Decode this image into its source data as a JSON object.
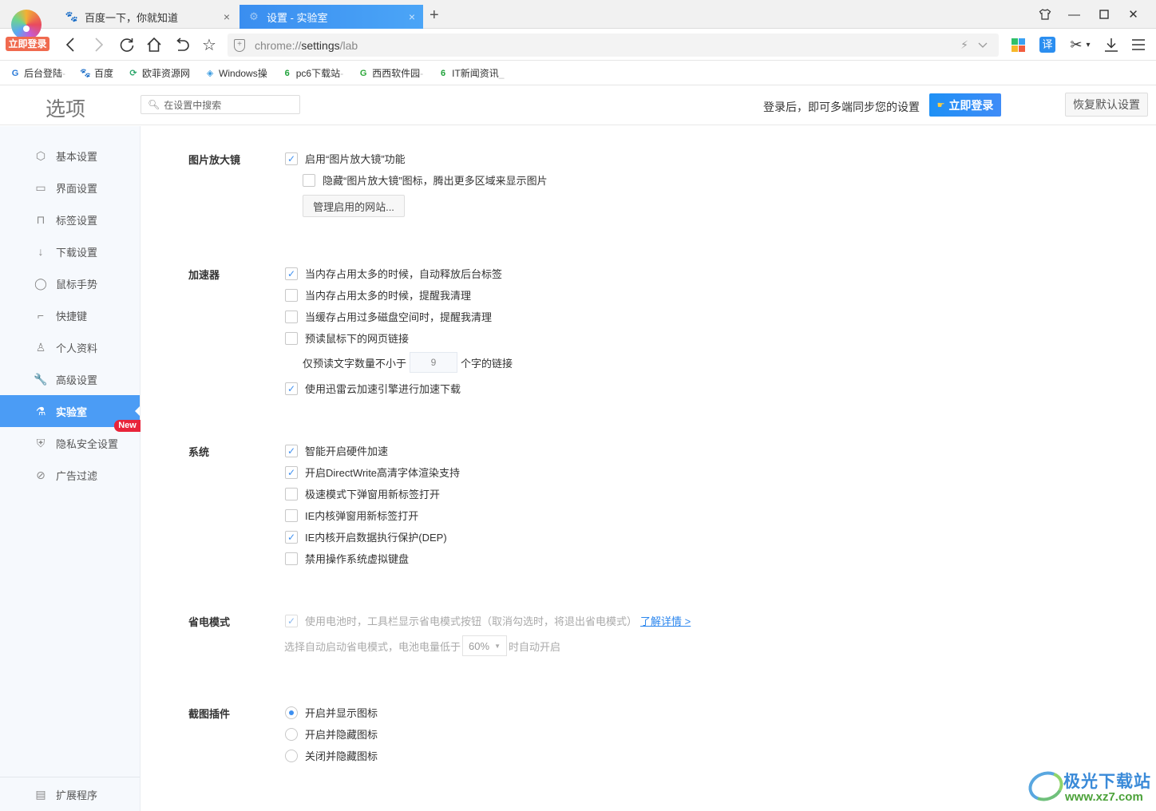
{
  "browser": {
    "logo_badge": "立即登录",
    "tabs": [
      {
        "title": "百度一下，你就知道",
        "icon": "baidu-paw-icon",
        "active": false,
        "close": "×"
      },
      {
        "title": "设置 - 实验室",
        "icon": "gear-icon",
        "active": true,
        "close": "×"
      }
    ],
    "new_tab": "+",
    "window_controls": {
      "skin": "shirt-icon",
      "minimize": "—",
      "maximize": "☐",
      "close": "✕"
    },
    "nav": {
      "back": "‹",
      "forward": "›",
      "reload": "↻",
      "home": "⌂",
      "undo": "↶",
      "bookmark": "☆"
    },
    "address": {
      "prefix": "chrome://",
      "main": "settings",
      "suffix": "/lab",
      "bolt": "⚡",
      "dropdown": "⌄"
    },
    "toolbar": {
      "translate": "译",
      "cut": "✂",
      "cut_dropdown": "▾",
      "download": "⤓",
      "menu": "☰"
    },
    "bookmarks": [
      {
        "label": "后台登陆",
        "trail": "-",
        "icon_char": "G",
        "color": "#2b7bd8"
      },
      {
        "label": "百度",
        "trail": "",
        "icon_char": "🐾",
        "color": "#2b5fd8"
      },
      {
        "label": "欧菲资源网",
        "trail": "",
        "icon_char": "⟳",
        "color": "#2aa66a"
      },
      {
        "label": "Windows操",
        "trail": "",
        "icon_char": "◈",
        "color": "#3a9be0"
      },
      {
        "label": "pc6下载站",
        "trail": "-",
        "icon_char": "6",
        "color": "#1fa23a"
      },
      {
        "label": "西西软件园",
        "trail": "-",
        "icon_char": "G",
        "color": "#2ea83b"
      },
      {
        "label": "IT新闻资讯",
        "trail": "_",
        "icon_char": "6",
        "color": "#1fa23a"
      }
    ]
  },
  "header": {
    "title": "选项",
    "search_placeholder": "在设置中搜索",
    "sync_text": "登录后，即可多端同步您的设置",
    "login_button": "立即登录",
    "reset_button": "恢复默认设置"
  },
  "sidebar": {
    "items": [
      {
        "label": "基本设置",
        "icon": "⬡",
        "icon_name": "basic-settings-icon"
      },
      {
        "label": "界面设置",
        "icon": "▭",
        "icon_name": "window-icon"
      },
      {
        "label": "标签设置",
        "icon": "⊓",
        "icon_name": "tab-icon"
      },
      {
        "label": "下载设置",
        "icon": "↓",
        "icon_name": "download-icon"
      },
      {
        "label": "鼠标手势",
        "icon": "◯",
        "icon_name": "mouse-icon"
      },
      {
        "label": "快捷键",
        "icon": "⌐",
        "icon_name": "keyboard-icon"
      },
      {
        "label": "个人资料",
        "icon": "♙",
        "icon_name": "user-icon"
      },
      {
        "label": "高级设置",
        "icon": "🔧",
        "icon_name": "wrench-icon"
      },
      {
        "label": "实验室",
        "icon": "⚗",
        "icon_name": "flask-icon",
        "active": true
      },
      {
        "label": "隐私安全设置",
        "icon": "⛨",
        "icon_name": "shield-icon"
      },
      {
        "label": "广告过滤",
        "icon": "⊘",
        "icon_name": "block-icon"
      }
    ],
    "new_badge": "New",
    "extensions": {
      "label": "扩展程序",
      "icon": "▤"
    }
  },
  "sections": {
    "magnifier": {
      "title": "图片放大镜",
      "options": [
        {
          "label": "启用“图片放大镜”功能",
          "checked": true
        },
        {
          "label": "隐藏“图片放大镜”图标，腾出更多区域来显示图片",
          "checked": false
        }
      ],
      "manage_button": "管理启用的网站..."
    },
    "accelerator": {
      "title": "加速器",
      "options": [
        {
          "label": "当内存占用太多的时候，自动释放后台标签",
          "checked": true
        },
        {
          "label": "当内存占用太多的时候，提醒我清理",
          "checked": false
        },
        {
          "label": "当缓存占用过多磁盘空间时，提醒我清理",
          "checked": false
        },
        {
          "label": "预读鼠标下的网页链接",
          "checked": false
        }
      ],
      "prefetch_prefix": "仅预读文字数量不小于",
      "prefetch_value": "9",
      "prefetch_suffix": "个字的链接",
      "thunder": {
        "label": "使用迅雷云加速引擎进行加速下载",
        "checked": true
      }
    },
    "system": {
      "title": "系统",
      "options": [
        {
          "label": "智能开启硬件加速",
          "checked": true
        },
        {
          "label": "开启DirectWrite高清字体渲染支持",
          "checked": true
        },
        {
          "label": "极速模式下弹窗用新标签打开",
          "checked": false
        },
        {
          "label": "IE内核弹窗用新标签打开",
          "checked": false
        },
        {
          "label": "IE内核开启数据执行保护(DEP)",
          "checked": true
        },
        {
          "label": "禁用操作系统虚拟键盘",
          "checked": false
        }
      ]
    },
    "power": {
      "title": "省电模式",
      "option": {
        "label": "使用电池时，工具栏显示省电模式按钮（取消勾选时，将退出省电模式）",
        "checked": true,
        "disabled": true
      },
      "learn_more": "了解详情 >",
      "auto_prefix": "选择自动启动省电模式，电池电量低于",
      "auto_value": "60%",
      "auto_suffix": "时自动开启"
    },
    "screenshot": {
      "title": "截图插件",
      "options": [
        {
          "label": "开启并显示图标",
          "selected": true
        },
        {
          "label": "开启并隐藏图标",
          "selected": false
        },
        {
          "label": "关闭并隐藏图标",
          "selected": false
        }
      ]
    }
  },
  "watermark": {
    "name": "极光下载站",
    "url": "www.xz7.com"
  },
  "colors": {
    "accent": "#4b9cf5",
    "login_btn": "#1e90f5",
    "new_badge": "#e8243a",
    "check": "#3d8ff0"
  }
}
